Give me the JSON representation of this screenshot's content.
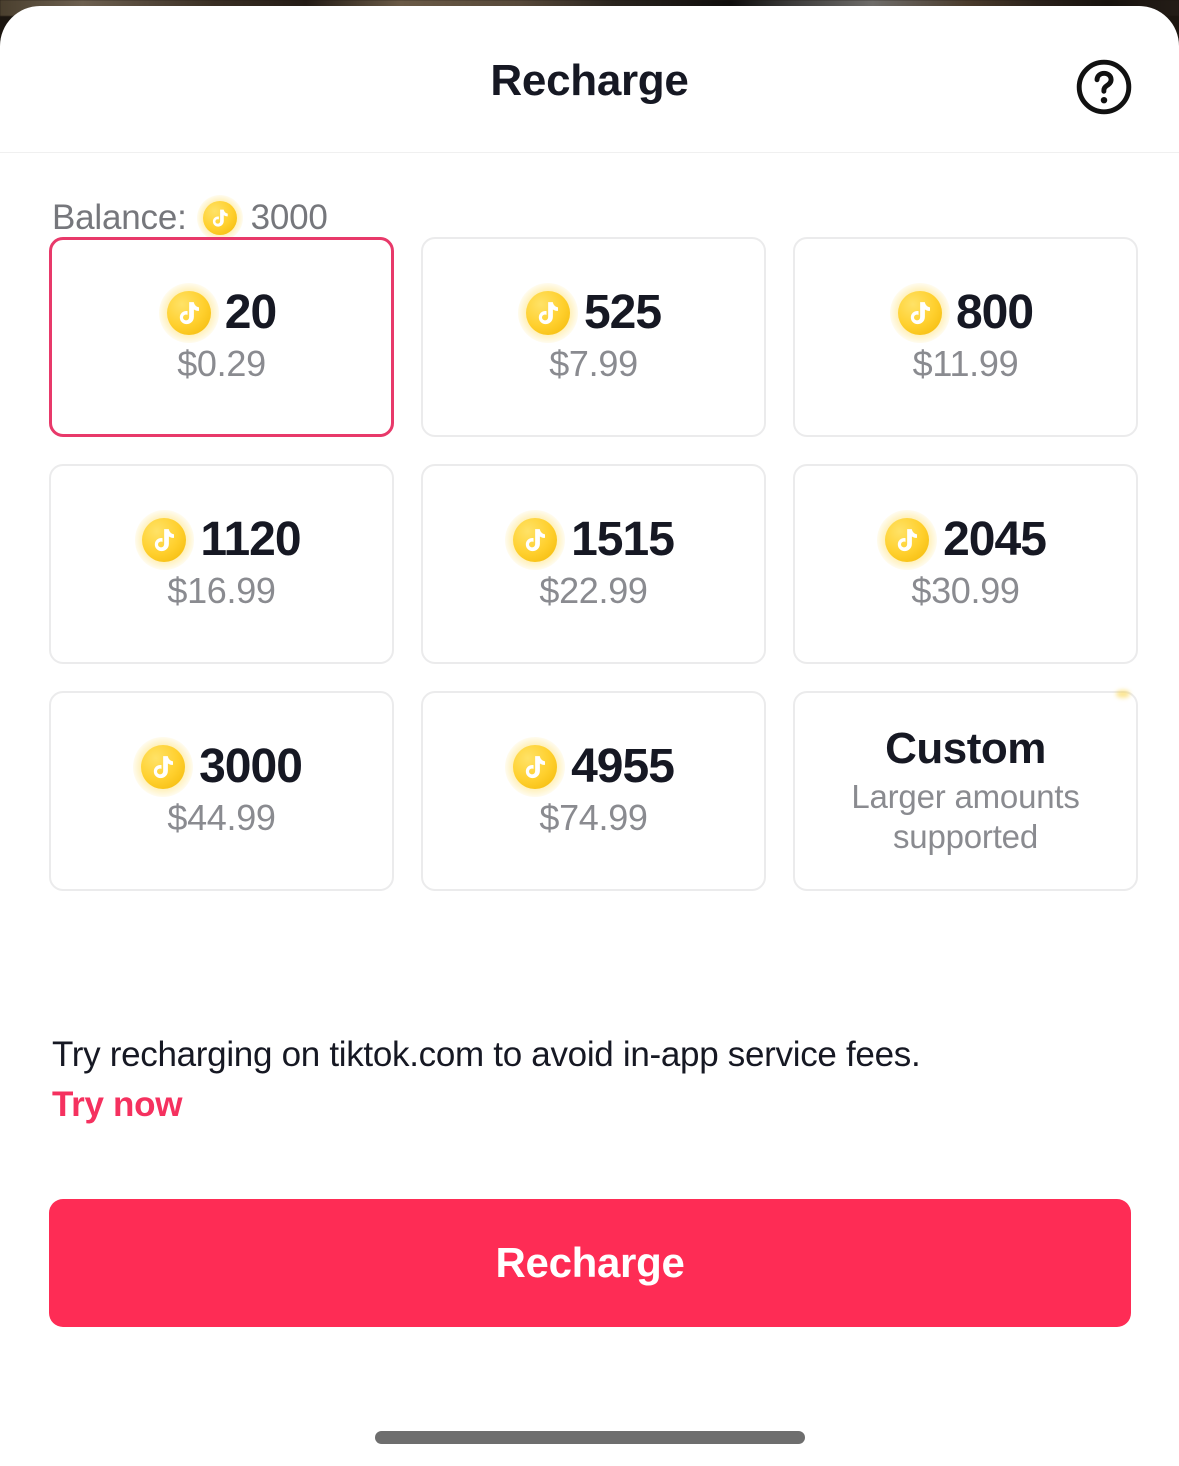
{
  "background": {
    "underlying_strip": "blurred-app-content"
  },
  "header": {
    "title": "Recharge",
    "help_icon": "question-mark-circle-icon"
  },
  "balance": {
    "label": "Balance:",
    "coin_icon": "tiktok-coin-icon",
    "value": "3000"
  },
  "amounts": [
    {
      "coins": "20",
      "price": "$0.29",
      "selected": true,
      "coin_icon": "tiktok-coin-icon"
    },
    {
      "coins": "525",
      "price": "$7.99",
      "selected": false,
      "coin_icon": "tiktok-coin-icon"
    },
    {
      "coins": "800",
      "price": "$11.99",
      "selected": false,
      "coin_icon": "tiktok-coin-icon"
    },
    {
      "coins": "1120",
      "price": "$16.99",
      "selected": false,
      "coin_icon": "tiktok-coin-icon"
    },
    {
      "coins": "1515",
      "price": "$22.99",
      "selected": false,
      "coin_icon": "tiktok-coin-icon"
    },
    {
      "coins": "2045",
      "price": "$30.99",
      "selected": false,
      "coin_icon": "tiktok-coin-icon"
    },
    {
      "coins": "3000",
      "price": "$44.99",
      "selected": false,
      "coin_icon": "tiktok-coin-icon"
    },
    {
      "coins": "4955",
      "price": "$74.99",
      "selected": false,
      "coin_icon": "tiktok-coin-icon"
    }
  ],
  "custom": {
    "title": "Custom",
    "subtitle": "Larger amounts supported"
  },
  "promo": {
    "text": "Try recharging on tiktok.com to avoid in-app service fees.",
    "link_label": "Try now"
  },
  "primary_action": {
    "label": "Recharge"
  },
  "colors": {
    "accent_red": "#FE2C55",
    "link_red": "#F5315F",
    "selected_border": "#E8396A",
    "coin_gold": "#FFD02E",
    "text_primary": "#161823",
    "text_muted": "#8A8B90",
    "card_border": "#EBEBEC"
  }
}
